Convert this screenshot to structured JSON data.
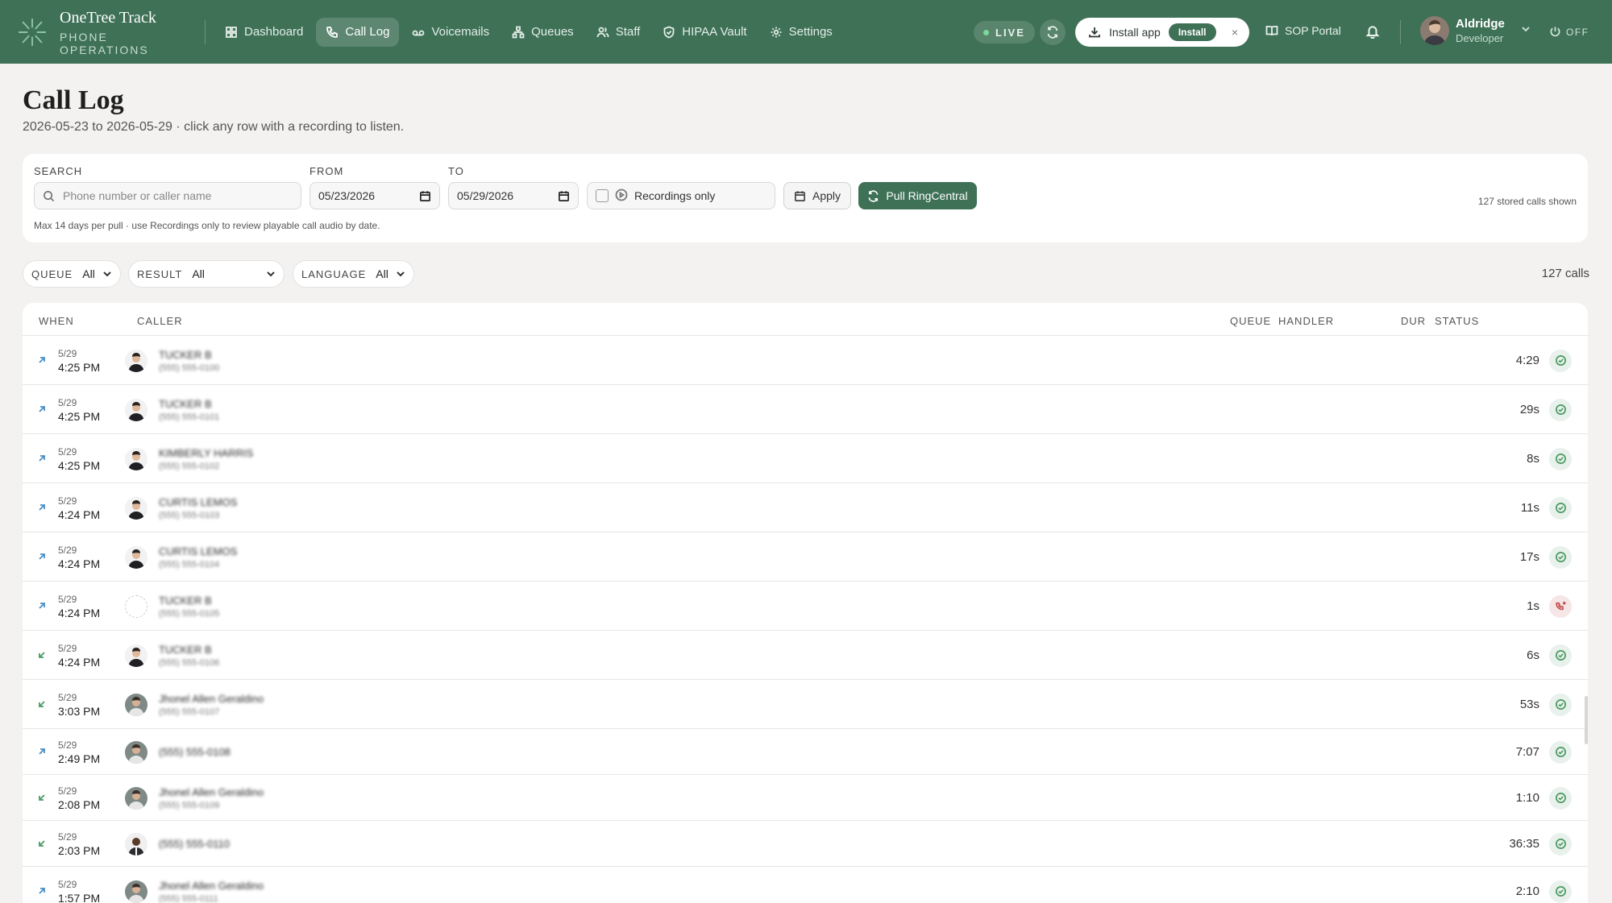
{
  "brand": {
    "name": "OneTree Track",
    "subtitle": "PHONE OPERATIONS"
  },
  "nav": [
    {
      "label": "Dashboard",
      "icon": "grid-icon"
    },
    {
      "label": "Call Log",
      "icon": "phone-icon",
      "active": true
    },
    {
      "label": "Voicemails",
      "icon": "voicemail-icon"
    },
    {
      "label": "Queues",
      "icon": "hierarchy-icon"
    },
    {
      "label": "Staff",
      "icon": "users-icon"
    },
    {
      "label": "HIPAA Vault",
      "icon": "shield-icon"
    },
    {
      "label": "Settings",
      "icon": "gear-icon"
    }
  ],
  "topbar": {
    "live": "LIVE",
    "install_text": "Install app",
    "install_button": "Install",
    "install_close": "×",
    "sop": "SOP Portal",
    "user_name": "Aldridge",
    "user_role": "Developer",
    "power": "OFF"
  },
  "header": {
    "title": "Call Log",
    "subtitle": "2026-05-23 to 2026-05-29 · click any row with a recording to listen."
  },
  "filters": {
    "search_label": "SEARCH",
    "search_placeholder": "Phone number or caller name",
    "from_label": "FROM",
    "from_value": "05/23/2026",
    "to_label": "TO",
    "to_value": "05/29/2026",
    "recordings_only": "Recordings only",
    "apply": "Apply",
    "pull": "Pull RingCentral",
    "hint": "Max 14 days per pull · use Recordings only to review playable call audio by date.",
    "stored": "127 stored calls shown"
  },
  "dropdowns": {
    "queue_label": "QUEUE",
    "queue_value": "All",
    "result_label": "RESULT",
    "result_value": "All",
    "language_label": "LANGUAGE",
    "language_value": "All",
    "count": "127 calls"
  },
  "table": {
    "headers": {
      "when": "WHEN",
      "caller": "CALLER",
      "queue": "QUEUE",
      "handler": "HANDLER",
      "dur": "DUR",
      "status": "STATUS"
    },
    "rows": [
      {
        "dir": "out",
        "date": "5/29",
        "time": "4:25 PM",
        "name": "TUCKER B",
        "sub": "(555) 555-0100",
        "avatar": "a",
        "dur": "4:29",
        "status": "completed"
      },
      {
        "dir": "out",
        "date": "5/29",
        "time": "4:25 PM",
        "name": "TUCKER B",
        "sub": "(555) 555-0101",
        "avatar": "a",
        "dur": "29s",
        "status": "completed"
      },
      {
        "dir": "out",
        "date": "5/29",
        "time": "4:25 PM",
        "name": "KIMBERLY HARRIS",
        "sub": "(555) 555-0102",
        "avatar": "a",
        "dur": "8s",
        "status": "completed"
      },
      {
        "dir": "out",
        "date": "5/29",
        "time": "4:24 PM",
        "name": "CURTIS LEMOS",
        "sub": "(555) 555-0103",
        "avatar": "a",
        "dur": "11s",
        "status": "completed"
      },
      {
        "dir": "out",
        "date": "5/29",
        "time": "4:24 PM",
        "name": "CURTIS LEMOS",
        "sub": "(555) 555-0104",
        "avatar": "a",
        "dur": "17s",
        "status": "completed"
      },
      {
        "dir": "out",
        "date": "5/29",
        "time": "4:24 PM",
        "name": "TUCKER B",
        "sub": "(555) 555-0105",
        "avatar": "none",
        "dur": "1s",
        "status": "missed"
      },
      {
        "dir": "in",
        "date": "5/29",
        "time": "4:24 PM",
        "name": "TUCKER B",
        "sub": "(555) 555-0106",
        "avatar": "a",
        "dur": "6s",
        "status": "completed"
      },
      {
        "dir": "in",
        "date": "5/29",
        "time": "3:03 PM",
        "name": "Jhonel Allen Geraldino",
        "sub": "(555) 555-0107",
        "avatar": "b",
        "dur": "53s",
        "status": "completed"
      },
      {
        "dir": "out",
        "date": "5/29",
        "time": "2:49 PM",
        "name": "(555) 555-0108",
        "sub": "",
        "avatar": "b",
        "dur": "7:07",
        "status": "completed"
      },
      {
        "dir": "in",
        "date": "5/29",
        "time": "2:08 PM",
        "name": "Jhonel Allen Geraldino",
        "sub": "(555) 555-0109",
        "avatar": "b",
        "dur": "1:10",
        "status": "completed"
      },
      {
        "dir": "in",
        "date": "5/29",
        "time": "2:03 PM",
        "name": "(555) 555-0110",
        "sub": "",
        "avatar": "c",
        "dur": "36:35",
        "status": "completed"
      },
      {
        "dir": "out",
        "date": "5/29",
        "time": "1:57 PM",
        "name": "Jhonel Allen Geraldino",
        "sub": "(555) 555-0111",
        "avatar": "b",
        "dur": "2:10",
        "status": "completed"
      }
    ]
  }
}
